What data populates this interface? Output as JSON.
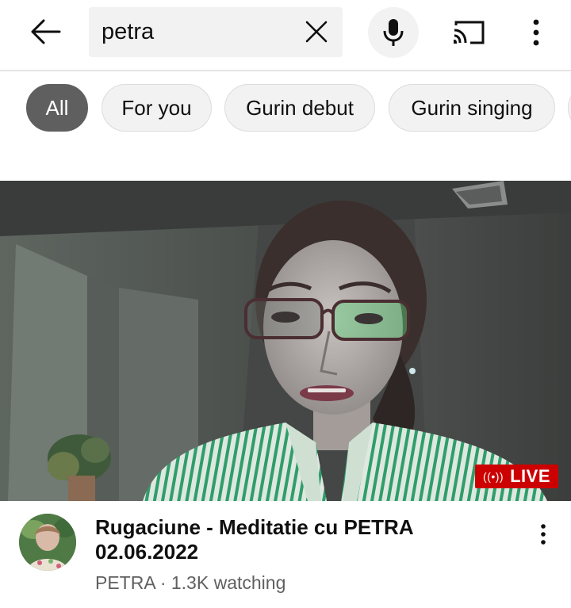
{
  "search": {
    "query": "petra",
    "back_icon": "arrow-back-icon",
    "clear_icon": "close-icon",
    "mic_icon": "mic-icon",
    "cast_icon": "cast-icon",
    "more_icon": "more-vert-icon"
  },
  "chips": [
    {
      "label": "All",
      "active": true
    },
    {
      "label": "For you",
      "active": false
    },
    {
      "label": "Gurin debut",
      "active": false
    },
    {
      "label": "Gurin singing",
      "active": false
    }
  ],
  "video": {
    "badge": "LIVE",
    "badge_color": "#cc0000",
    "title": "Rugaciune - Meditatie cu PETRA 02.06.2022",
    "channel": "PETRA",
    "separator": "·",
    "viewers": "1.3K watching"
  }
}
